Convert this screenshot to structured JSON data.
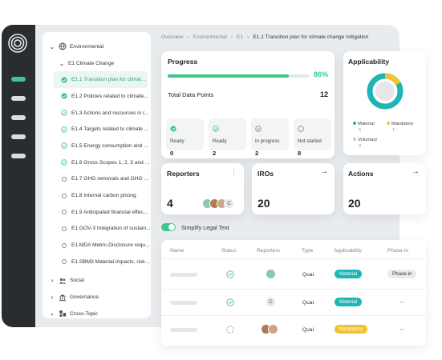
{
  "rail": {
    "items": [
      "nav-1",
      "nav-2",
      "nav-3",
      "nav-4",
      "nav-5"
    ]
  },
  "tree": {
    "environmental": "Environmental",
    "climate_change": "E1 Climate Change",
    "items": [
      {
        "label": "E1.1 Transition plan for climate...",
        "status": "done",
        "selected": true
      },
      {
        "label": "E1.2 Policies related to climate...",
        "status": "done"
      },
      {
        "label": "E1.3 Actions and resources in r...",
        "status": "check"
      },
      {
        "label": "E1.4 Targets related to climate ...",
        "status": "check"
      },
      {
        "label": "E1.5 Energy consumption and m...",
        "status": "check"
      },
      {
        "label": "E1.6 Gross Scopes 1, 2, 3 and T...",
        "status": "check"
      },
      {
        "label": "E1.7 GHG removals and GHG m...",
        "status": "empty"
      },
      {
        "label": "E1.8 Internal carbon pricing",
        "status": "empty"
      },
      {
        "label": "E1.9 Anticipated financial effec...",
        "status": "empty"
      },
      {
        "label": "E1.GOV-3 Integration of sustain...",
        "status": "empty"
      },
      {
        "label": "E1.MDA Metric-Disclosure requ...",
        "status": "empty"
      },
      {
        "label": "E1.SBM3 Material impacts, risk...",
        "status": "empty"
      }
    ],
    "social": "Social",
    "governance": "Governance",
    "cross_topic": "Cross-Topic"
  },
  "breadcrumb": [
    "Overview",
    "Environmental",
    "E1",
    "E1.1 Transition plan for climate change mitigation"
  ],
  "progress": {
    "title": "Progress",
    "percent_label": "86%",
    "fraction": 0.86,
    "total_label": "Total Data Points",
    "total_value": "12",
    "stats": [
      {
        "label": "Ready",
        "value": "0"
      },
      {
        "label": "Ready",
        "value": "2"
      },
      {
        "label": "In progress",
        "value": "2"
      },
      {
        "label": "Not started",
        "value": "8"
      }
    ]
  },
  "applicability": {
    "title": "Applicability",
    "legend": [
      {
        "label": "Material",
        "value": "5",
        "color": "#1fb5b5"
      },
      {
        "label": "Mandatory",
        "value": "1",
        "color": "#f2c230"
      },
      {
        "label": "Voluntary",
        "value": "0",
        "color": "#cccccc"
      }
    ]
  },
  "reporters": {
    "title": "Reporters",
    "count": "4",
    "more": "C"
  },
  "iros": {
    "title": "IROs",
    "count": "20"
  },
  "actions": {
    "title": "Actions",
    "count": "20"
  },
  "simplify_label": "Simplify Legal Text",
  "table": {
    "headers": [
      "Name",
      "Status",
      "Reporters",
      "Type",
      "Applicability",
      "Phase-in"
    ],
    "rows": [
      {
        "type": "Qual.",
        "applicability": "Material",
        "phase": "Phase-in"
      },
      {
        "type": "Qual.",
        "applicability": "Material",
        "phase": "–",
        "reporter": "C"
      },
      {
        "type": "Qual.",
        "applicability": "Mandatory",
        "phase": "–"
      }
    ]
  },
  "colors": {
    "accent": "#3ec58b",
    "teal": "#1fb5b5",
    "yellow": "#f2c230",
    "rail": "#2a2d30"
  }
}
